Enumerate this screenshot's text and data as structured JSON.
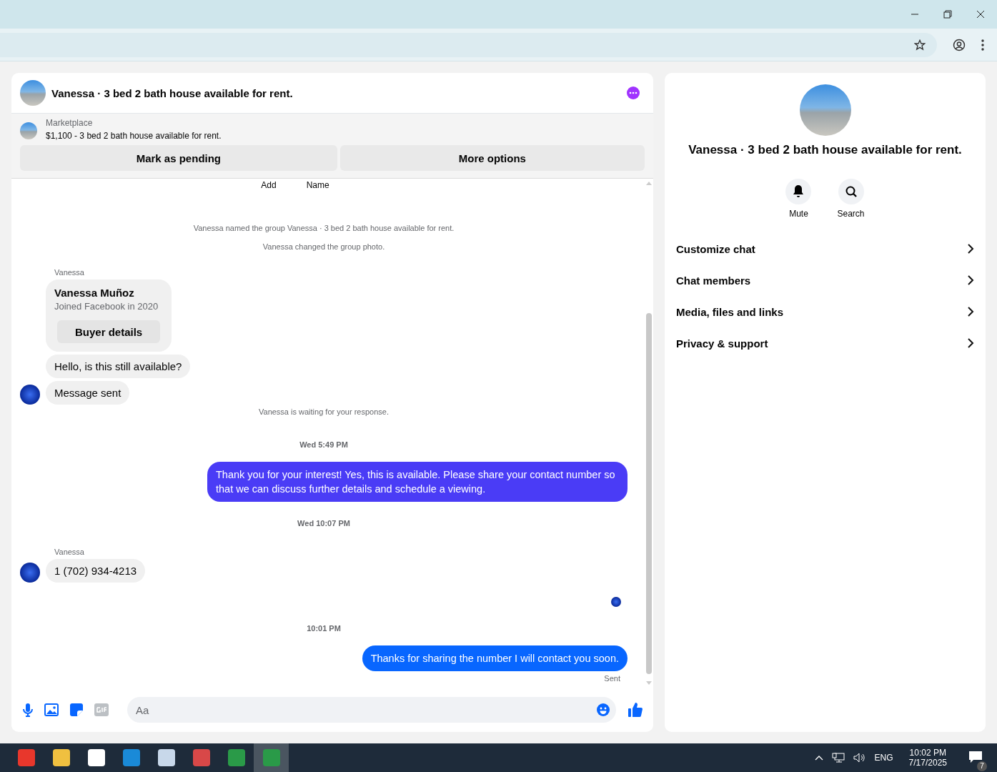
{
  "chat": {
    "title": "Vanessa · 3 bed 2 bath house available for rent.",
    "listing": {
      "source": "Marketplace",
      "text": "$1,100 - 3 bed 2 bath house available for rent."
    },
    "actions": [
      "Mark as pending",
      "More options"
    ],
    "top_actions": [
      "Add",
      "Name"
    ],
    "messages": [
      {
        "kind": "system",
        "text": "Vanessa named the group Vanessa · 3 bed 2 bath house available for rent."
      },
      {
        "kind": "system",
        "text": "Vanessa changed the group photo."
      },
      {
        "kind": "sender",
        "text": "Vanessa"
      },
      {
        "kind": "card",
        "title": "Vanessa Muñoz",
        "subtitle": "Joined Facebook in 2020",
        "button": "Buyer details"
      },
      {
        "kind": "incoming",
        "text": "Hello, is this still available?",
        "avatar": false
      },
      {
        "kind": "incoming",
        "text": "Message sent",
        "avatar": true
      },
      {
        "kind": "system",
        "text": "Vanessa is waiting for your response."
      },
      {
        "kind": "time",
        "text": "Wed 5:49 PM"
      },
      {
        "kind": "outgoing",
        "text": "Thank you for your interest! Yes, this is available. Please share your contact number so that we can discuss further details and schedule a viewing.",
        "color": "#4a3cf6"
      },
      {
        "kind": "time",
        "text": "Wed 10:07 PM"
      },
      {
        "kind": "sender",
        "text": "Vanessa"
      },
      {
        "kind": "incoming",
        "text": "1 (702) 934-4213",
        "avatar": true
      },
      {
        "kind": "seen"
      },
      {
        "kind": "time",
        "text": "10:01 PM"
      },
      {
        "kind": "outgoing",
        "text": "Thanks for sharing the number I will contact you soon.",
        "color": "#0866ff"
      },
      {
        "kind": "status",
        "text": "Sent"
      }
    ],
    "composer": {
      "placeholder": "Aa"
    }
  },
  "info": {
    "title": "Vanessa · 3 bed 2 bath house available for rent.",
    "quick_actions": [
      {
        "kind": "bell",
        "label": "Mute"
      },
      {
        "kind": "search",
        "label": "Search"
      }
    ],
    "menu": [
      "Customize chat",
      "Chat members",
      "Media, files and links",
      "Privacy & support"
    ]
  },
  "taskbar": {
    "language": "ENG",
    "time": "10:02 PM",
    "date": "7/17/2025",
    "notifications": "7"
  }
}
